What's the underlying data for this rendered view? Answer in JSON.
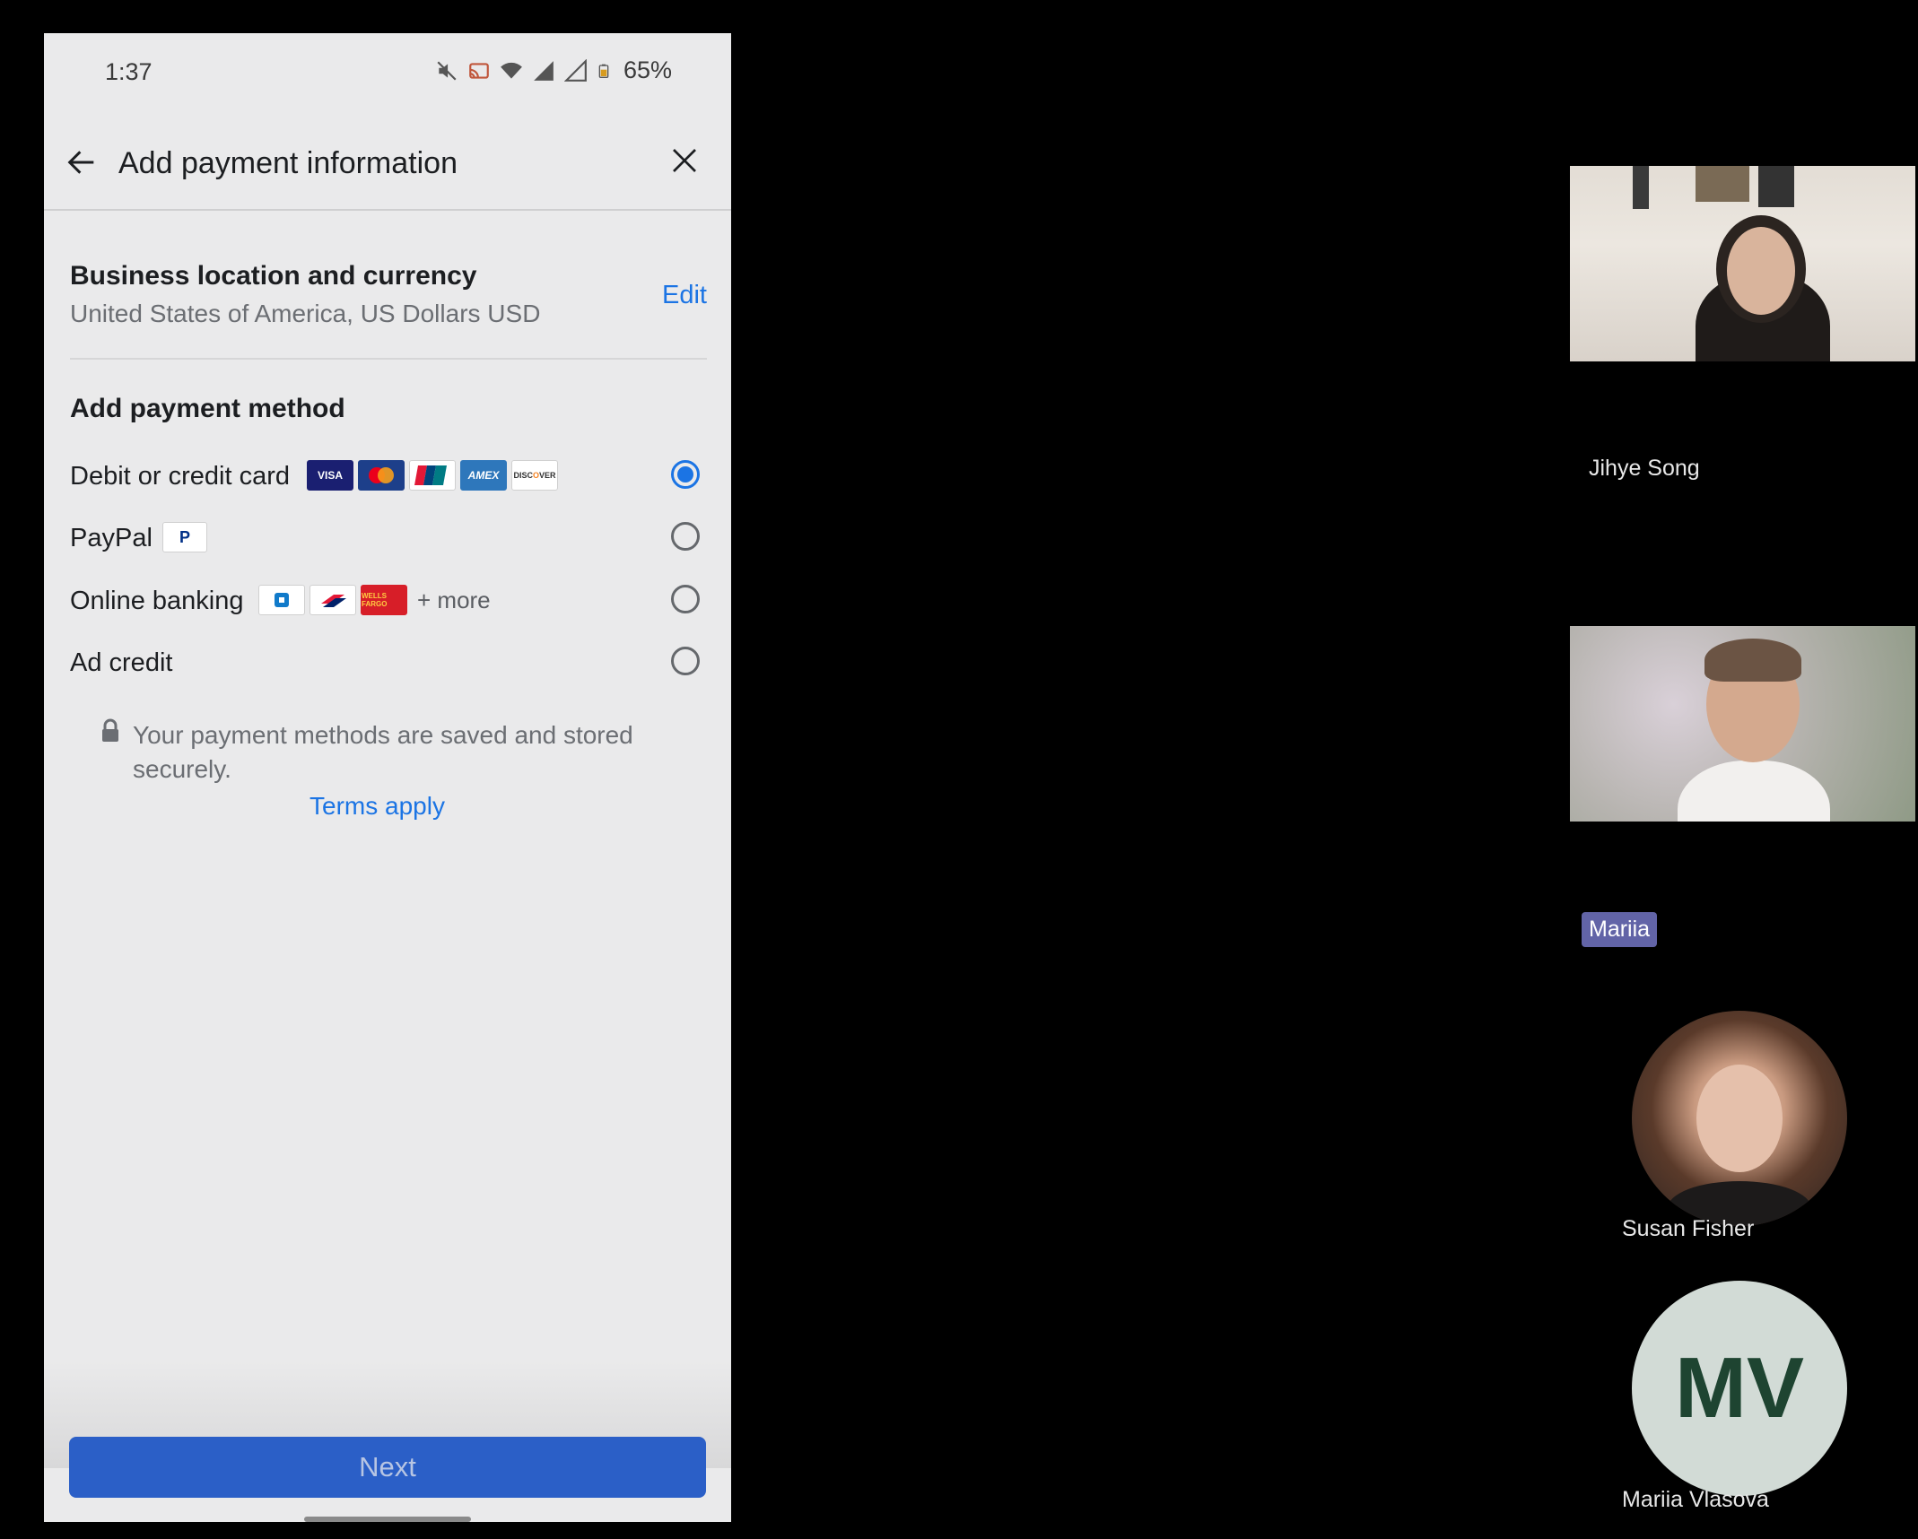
{
  "status_bar": {
    "time": "1:37",
    "battery": "65%",
    "icons": [
      "mute-icon",
      "cast-icon",
      "wifi-icon",
      "signal-icon",
      "signal-roaming-icon",
      "battery-icon"
    ]
  },
  "app_bar": {
    "title": "Add payment information"
  },
  "business_location": {
    "title": "Business location and currency",
    "value": "United States of America, US Dollars USD",
    "edit_label": "Edit"
  },
  "payment": {
    "section_title": "Add payment method",
    "methods": [
      {
        "label": "Debit or credit card",
        "selected": true,
        "logos": [
          "VISA",
          "Mastercard",
          "UnionPay",
          "AMEX",
          "DISCOVER"
        ]
      },
      {
        "label": "PayPal",
        "selected": false,
        "logos": [
          "PayPal"
        ]
      },
      {
        "label": "Online banking",
        "selected": false,
        "logos": [
          "Chase",
          "Bank of America",
          "Wells Fargo"
        ],
        "more": "+ more"
      },
      {
        "label": "Ad credit",
        "selected": false
      }
    ],
    "secure_note": "Your payment methods are saved and stored securely.",
    "terms_label": "Terms apply",
    "next_label": "Next"
  },
  "participants": [
    {
      "name": "Jihye Song",
      "type": "video"
    },
    {
      "name": "Mariia",
      "type": "video"
    },
    {
      "name": "Susan Fisher",
      "type": "avatar-photo"
    },
    {
      "name": "Mariia Vlasova",
      "type": "avatar-initials",
      "initials": "MV"
    }
  ],
  "colors": {
    "accent": "#1b74e4",
    "button": "#2b5fc7",
    "badge": "#6264a7",
    "screen_bg": "#eaeaeb"
  }
}
